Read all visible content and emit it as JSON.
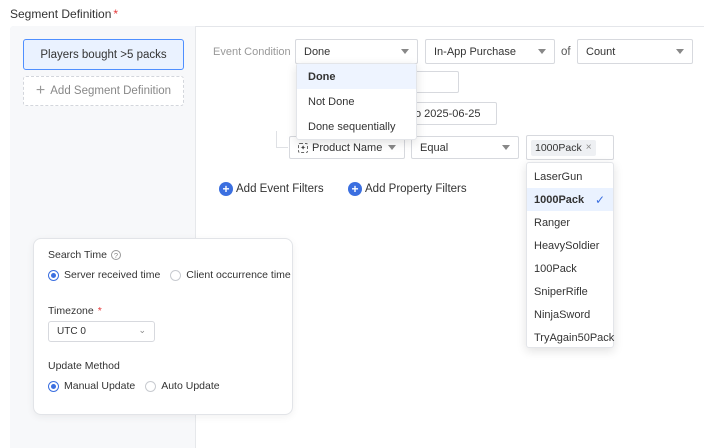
{
  "header": {
    "title": "Segment Definition",
    "required_mark": "*"
  },
  "segments": {
    "items": [
      {
        "label": "Players bought >5 packs"
      }
    ],
    "add_label": "Add Segment Definition"
  },
  "condition": {
    "label": "Event Condition",
    "done_select": "Done",
    "event_select": "In-App Purchase",
    "of_label": "of",
    "metric_select": "Count",
    "date_fragment": "o 2025-06-25"
  },
  "done_menu": {
    "options": [
      "Done",
      "Not Done",
      "Done sequentially"
    ],
    "active_index": 0
  },
  "filter": {
    "property_select": "Product Name",
    "operator_select": "Equal",
    "value_tag": "1000Pack",
    "tag_remove": "×"
  },
  "value_dropdown": {
    "options": [
      "LaserGun",
      "1000Pack",
      "Ranger",
      "HeavySoldier",
      "100Pack",
      "SniperRifle",
      "NinjaSword",
      "TryAgain50Pack"
    ],
    "selected_index": 1,
    "check_mark": "✓"
  },
  "actions": {
    "add_event_filters": "Add Event Filters",
    "add_property_filters": "Add Property Filters"
  },
  "settings": {
    "search_time": {
      "label": "Search Time",
      "options": [
        "Server received time",
        "Client occurrence time"
      ],
      "selected_index": 0
    },
    "timezone": {
      "label": "Timezone",
      "required_mark": "*",
      "value": "UTC 0"
    },
    "update_method": {
      "label": "Update Method",
      "options": [
        "Manual Update",
        "Auto Update"
      ],
      "selected_index": 0
    }
  },
  "colors": {
    "accent": "#3b6fe0",
    "required": "#e5393a",
    "selected_bg": "#eaf2ff"
  }
}
